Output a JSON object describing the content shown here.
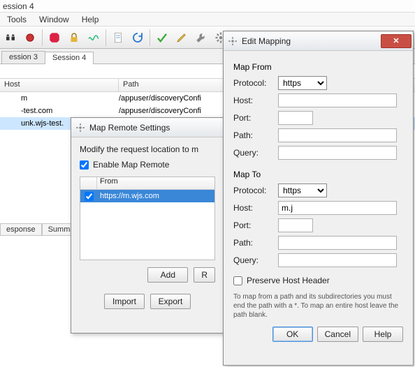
{
  "window": {
    "title": "ession 4"
  },
  "menu": {
    "tools": "Tools",
    "window": "Window",
    "help": "Help"
  },
  "tabs": {
    "t3": "ession 3",
    "t4": "Session 4"
  },
  "list": {
    "header_host": "Host",
    "header_path": "Path",
    "rows": [
      {
        "host": "m",
        "path": "/appuser/discoveryConfi"
      },
      {
        "host": "-test.com",
        "path": "/appuser/discoveryConfi"
      },
      {
        "host": "unk.wjs-test.",
        "path": ""
      },
      {
        "host": "",
        "path": ""
      },
      {
        "host": "",
        "path": ""
      },
      {
        "host": "",
        "path": ""
      }
    ]
  },
  "bottom_tabs": {
    "response": "esponse",
    "summary": "Summary"
  },
  "map_remote": {
    "title": "Map Remote Settings",
    "desc": "Modify the request location to m",
    "enable_label": "Enable Map Remote",
    "enable_checked": true,
    "from_header": "From",
    "entry_checked": true,
    "entry_url": "https://m.wjs.com",
    "add": "Add",
    "r": "R",
    "import": "Import",
    "export": "Export"
  },
  "edit_mapping": {
    "title": "Edit Mapping",
    "from_title": "Map From",
    "to_title": "Map To",
    "labels": {
      "protocol": "Protocol:",
      "host": "Host:",
      "port": "Port:",
      "path": "Path:",
      "query": "Query:"
    },
    "from": {
      "protocol": "https",
      "host": "",
      "port": "",
      "path": "",
      "query": ""
    },
    "to": {
      "protocol": "https",
      "host": "m.j",
      "port": "",
      "path": "",
      "query": ""
    },
    "preserve_label": "Preserve Host Header",
    "preserve_checked": false,
    "hint": "To map from a path and its subdirectories you must end the path with a *. To map an entire host leave the path blank.",
    "ok": "OK",
    "cancel": "Cancel",
    "help": "Help"
  },
  "icons": {
    "binoculars": "binoculars-icon",
    "record": "record-icon",
    "stop": "stop-icon",
    "lock": "lock-icon",
    "wave": "wave-icon",
    "document": "document-icon",
    "refresh": "refresh-icon",
    "check": "check-icon",
    "pencil": "pencil-icon",
    "wrench": "wrench-icon",
    "gear": "gear-icon"
  }
}
